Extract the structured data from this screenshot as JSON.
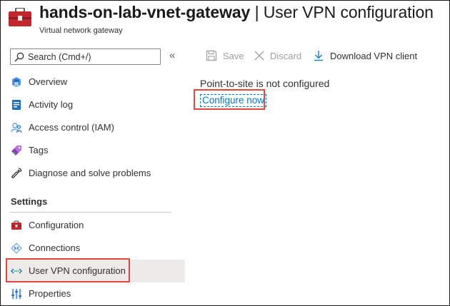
{
  "header": {
    "resource_name": "hands-on-lab-vnet-gateway",
    "separator": "|",
    "page_name": "User VPN configuration",
    "subtitle": "Virtual network gateway"
  },
  "search": {
    "placeholder": "Search (Cmd+/)"
  },
  "sidebar": {
    "collapse_glyph": "«",
    "items": [
      {
        "label": "Overview",
        "icon": "overview-icon"
      },
      {
        "label": "Activity log",
        "icon": "activity-log-icon"
      },
      {
        "label": "Access control (IAM)",
        "icon": "iam-icon"
      },
      {
        "label": "Tags",
        "icon": "tag-icon"
      },
      {
        "label": "Diagnose and solve problems",
        "icon": "wrench-icon"
      }
    ],
    "settings_heading": "Settings",
    "settings_items": [
      {
        "label": "Configuration",
        "icon": "toolbox-icon"
      },
      {
        "label": "Connections",
        "icon": "connections-icon"
      },
      {
        "label": "User VPN configuration",
        "icon": "vpn-icon",
        "selected": true
      },
      {
        "label": "Properties",
        "icon": "properties-icon"
      }
    ]
  },
  "toolbar": {
    "save_label": "Save",
    "discard_label": "Discard",
    "download_label": "Download VPN client"
  },
  "main": {
    "message": "Point-to-site is not configured",
    "configure_link": "Configure now"
  },
  "colors": {
    "accent": "#0078d4",
    "highlight": "#e0483d",
    "selected_bg": "#edebe9"
  }
}
